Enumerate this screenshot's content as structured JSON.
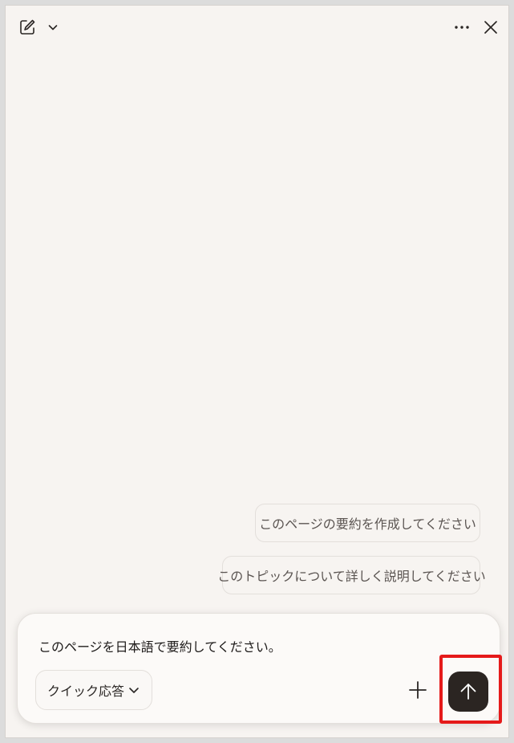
{
  "toolbar": {
    "new_chat_icon": "compose-icon",
    "new_chat_chevron_icon": "chevron-down-icon",
    "more_icon": "more-horizontal-icon",
    "close_icon": "close-icon"
  },
  "suggestions": [
    {
      "label": "このページの要約を作成してください"
    },
    {
      "label": "このトピックについて詳しく説明してください"
    }
  ],
  "composer": {
    "input_value": "このページを日本語で要約してください。",
    "mode_label": "クイック応答",
    "attach_icon": "plus-icon",
    "send_icon": "arrow-up-icon"
  },
  "colors": {
    "background": "#f7f4f1",
    "send_button": "#2b2522",
    "highlight": "#e51a1a"
  }
}
